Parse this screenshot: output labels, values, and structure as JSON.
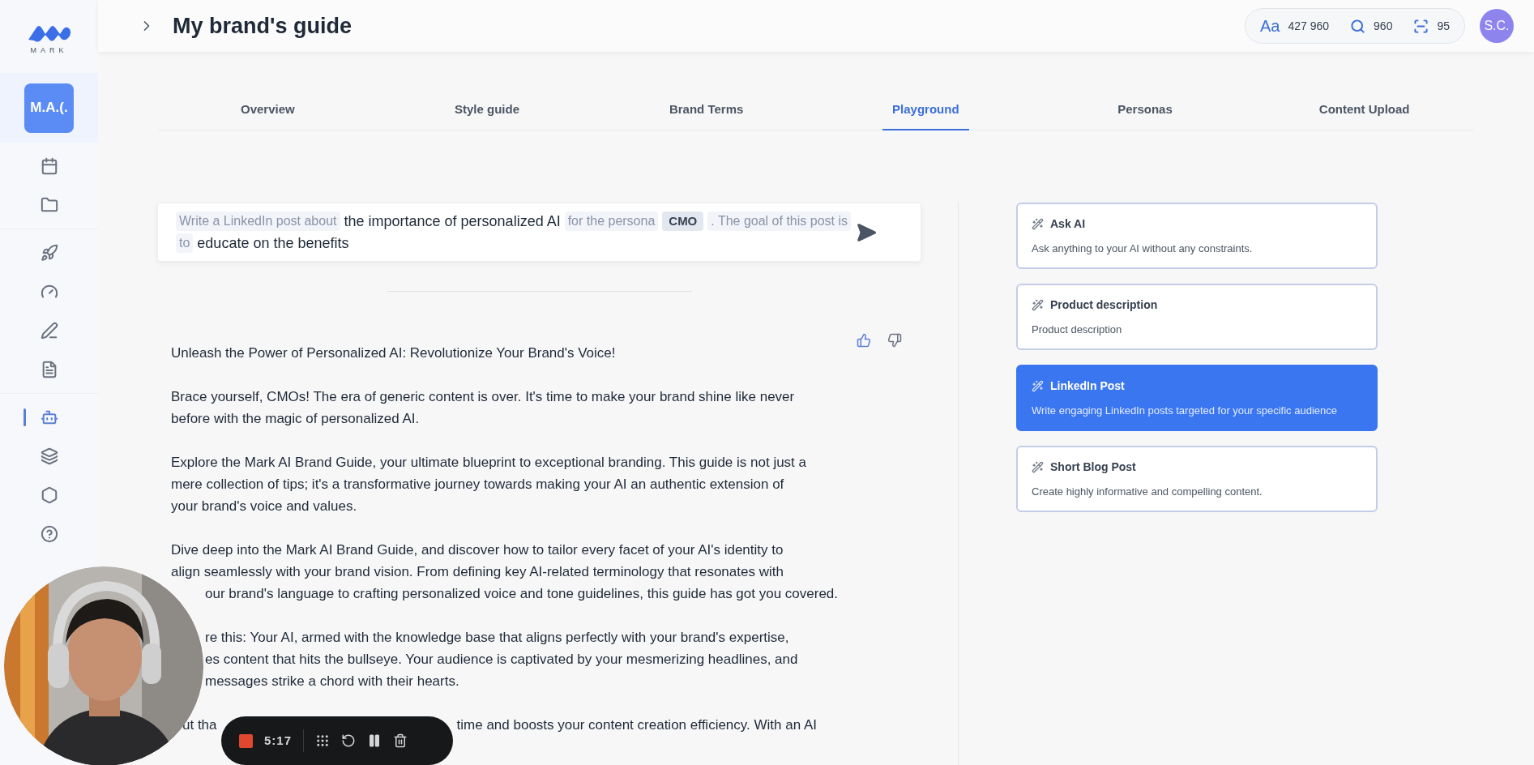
{
  "logo": {
    "text": "MARK"
  },
  "sidebar": {
    "workspace": {
      "label": "M.A.(.",
      "selected": true
    },
    "groups": [
      [
        {
          "selected": false
        },
        {
          "selected": false
        }
      ],
      [
        {
          "selected": false
        },
        {
          "selected": false
        },
        {
          "selected": false
        },
        {
          "selected": false
        }
      ],
      [
        {
          "selected": true
        },
        {
          "selected": false
        },
        {
          "selected": false
        },
        {
          "selected": false
        }
      ]
    ]
  },
  "header": {
    "title": "My brand's guide",
    "font_label": "Aa",
    "words": "427 960",
    "searches": "960",
    "scans": "95",
    "avatar": "S.C."
  },
  "tabs": [
    {
      "label": "Overview",
      "selected": false
    },
    {
      "label": "Style guide",
      "selected": false
    },
    {
      "label": "Brand Terms",
      "selected": false
    },
    {
      "label": "Playground",
      "selected": true
    },
    {
      "label": "Personas",
      "selected": false
    },
    {
      "label": "Content Upload",
      "selected": false
    }
  ],
  "prompt": [
    {
      "kind": "fixed",
      "text": "Write a LinkedIn post about"
    },
    {
      "kind": "value",
      "text": "the importance of personalized AI"
    },
    {
      "kind": "fixed",
      "text": "for the persona"
    },
    {
      "kind": "tag",
      "text": "CMO"
    },
    {
      "kind": "fixed",
      "text": ". The goal of this post is"
    },
    {
      "kind": "fixed",
      "text": "to"
    },
    {
      "kind": "value",
      "text": "educate on the benefits"
    }
  ],
  "response": [
    [
      {
        "covered": false,
        "fragments": [
          "Unleash the Power of Personalized AI: Revolutionize Your Brand's Voice!"
        ]
      }
    ],
    [
      {
        "covered": false,
        "fragments": [
          "Brace yourself, CMOs! The era of generic content is over. It's time to make your brand shine like never"
        ]
      },
      {
        "covered": false,
        "fragments": [
          "before with the magic of personalized AI."
        ]
      }
    ],
    [
      {
        "covered": false,
        "fragments": [
          "Explore the Mark AI Brand Guide, your ultimate blueprint to exceptional branding. This guide is not just a"
        ]
      },
      {
        "covered": false,
        "fragments": [
          "mere collection of tips; it's a transformative journey towards making your AI an authentic extension of"
        ]
      },
      {
        "covered": false,
        "fragments": [
          "your brand's voice and values."
        ]
      }
    ],
    [
      {
        "covered": false,
        "fragments": [
          "Dive deep into the Mark AI Brand Guide, and discover how to tailor every facet of your AI's identity to"
        ]
      },
      {
        "covered": false,
        "fragments": [
          "align seamlessly with your brand vision. From defining key AI-related terminology that resonates with"
        ]
      },
      {
        "covered": true,
        "fragments": [
          "our brand's language to crafting personalized voice and tone guidelines, this guide has got you covered."
        ]
      }
    ],
    [
      {
        "covered": true,
        "fragments": [
          "re this: Your AI, armed with the knowledge base that aligns perfectly with your brand's expertise,"
        ]
      },
      {
        "covered": true,
        "fragments": [
          "es content that hits the bullseye. Your audience is captivated by your mesmerizing headlines, and"
        ]
      },
      {
        "covered": true,
        "fragments": [
          "messages strike a chord with their hearts."
        ]
      }
    ],
    [
      {
        "covered": true,
        "fragments": [
          "ut tha",
          "time and boosts your content creation efficiency. With an AI"
        ]
      }
    ]
  ],
  "templates": [
    {
      "title": "Ask AI",
      "description": "Ask anything to your AI without any constraints.",
      "selected": false
    },
    {
      "title": "Product description",
      "description": "Product description",
      "selected": false
    },
    {
      "title": "LinkedIn Post",
      "description": "Write engaging LinkedIn posts targeted for your specific audience",
      "selected": true
    },
    {
      "title": "Short Blog Post",
      "description": "Create highly informative and compelling content.",
      "selected": false
    }
  ],
  "recorder": {
    "time": "5:17"
  }
}
